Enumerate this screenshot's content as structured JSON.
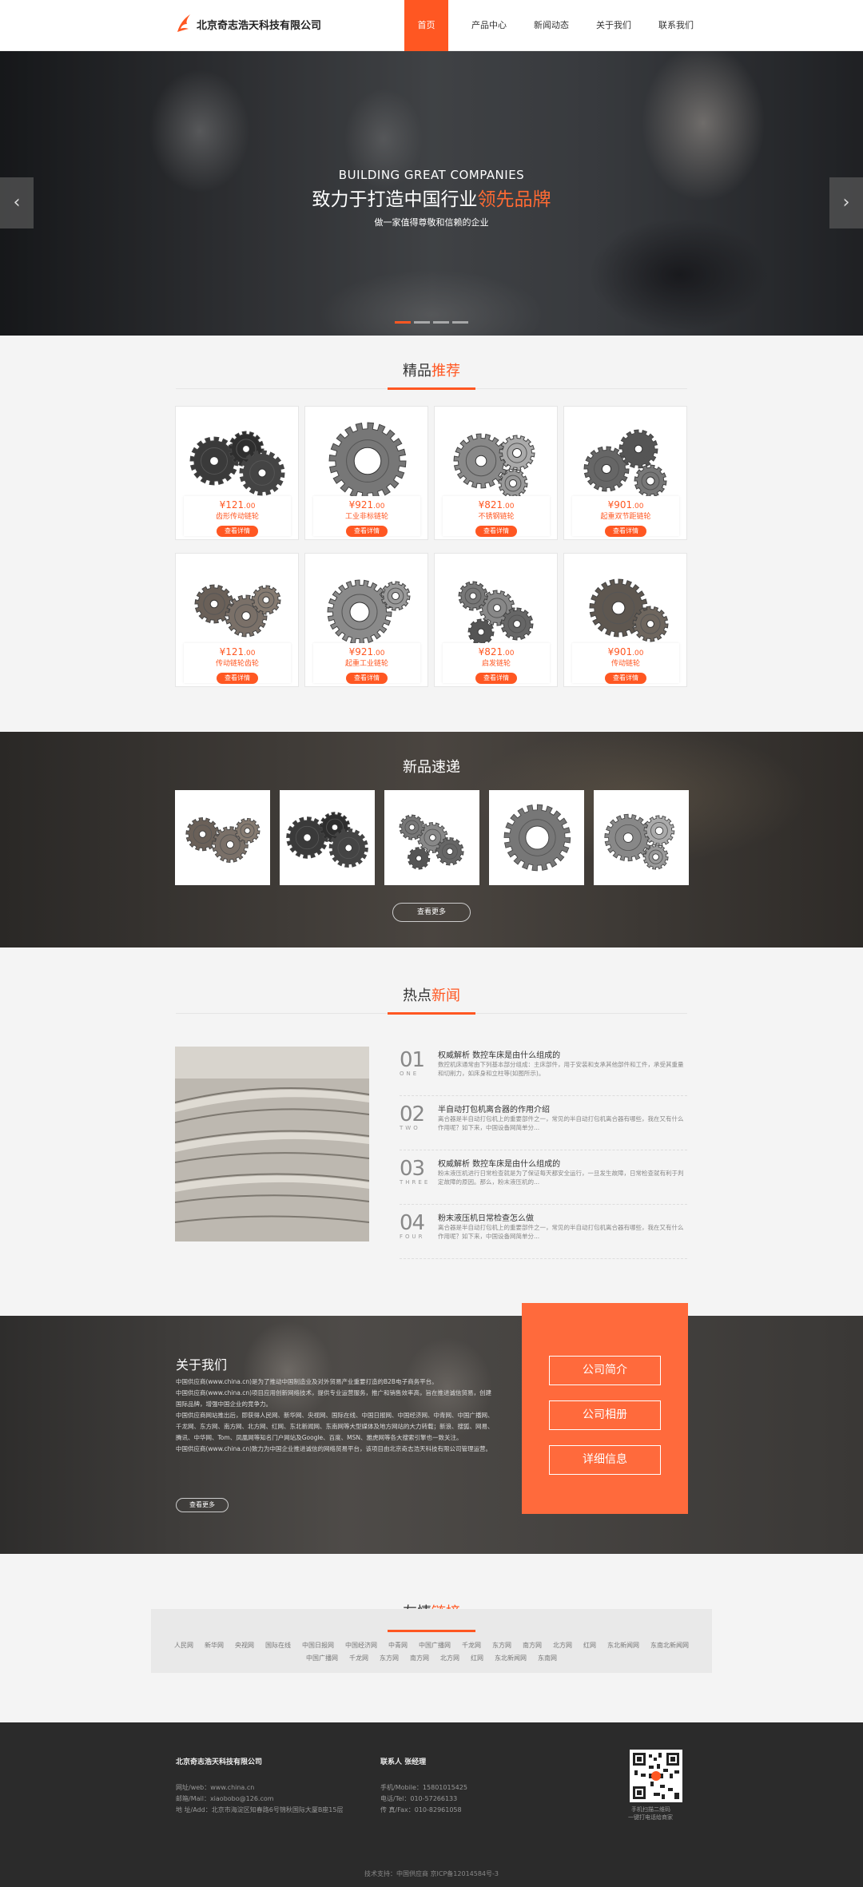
{
  "header": {
    "company": "北京奇志浩天科技有限公司",
    "nav": [
      "首页",
      "产品中心",
      "新闻动态",
      "关于我们",
      "联系我们"
    ]
  },
  "hero": {
    "en": "BUILDING GREAT COMPANIES",
    "cn_prefix": "致力于打造中国行业",
    "cn_accent": "领先品牌",
    "sub": "做一家值得尊敬和信赖的企业",
    "prev": "‹",
    "next": "›"
  },
  "featured": {
    "title_a": "精品",
    "title_b": "推荐",
    "button": "查看详情",
    "items": [
      {
        "price": "¥121",
        "cents": ".00",
        "name": "齿形传动链轮"
      },
      {
        "price": "¥921",
        "cents": ".00",
        "name": "工业非标链轮"
      },
      {
        "price": "¥821",
        "cents": ".00",
        "name": "不锈钢链轮"
      },
      {
        "price": "¥901",
        "cents": ".00",
        "name": "起重双节距链轮"
      },
      {
        "price": "¥121",
        "cents": ".00",
        "name": "传动链轮齿轮"
      },
      {
        "price": "¥921",
        "cents": ".00",
        "name": "起重工业链轮"
      },
      {
        "price": "¥821",
        "cents": ".00",
        "name": "启发链轮"
      },
      {
        "price": "¥901",
        "cents": ".00",
        "name": "传动链轮"
      }
    ]
  },
  "new_products": {
    "title": "新品速递",
    "more": "查看更多"
  },
  "news": {
    "title_a": "热点",
    "title_b": "新闻",
    "items": [
      {
        "num": "01",
        "label": "ONE",
        "title": "权威解析 数控车床是由什么组成的",
        "desc": "数控机床通常由下列基本部分组成：主床部件，用于安装和支承其他部件和工件，承受其重量和切削力，如床身和立柱等(如图所示)。"
      },
      {
        "num": "02",
        "label": "TWO",
        "title": "半自动打包机离合器的作用介绍",
        "desc": "离合器是半自动打包机上的重要部件之一，常见的半自动打包机离合器有哪些，我在又有什么作用呢？如下来，中国设备网简单分..."
      },
      {
        "num": "03",
        "label": "THREE",
        "title": "权威解析 数控车床是由什么组成的",
        "desc": "粉末液压机进行日常检查就是为了保证每天都安全运行，一旦发生故障，日常检查就有利于判定故障的原因。那么，粉末液压机的..."
      },
      {
        "num": "04",
        "label": "FOUR",
        "title": "粉末液压机日常检查怎么做",
        "desc": "离合器是半自动打包机上的重要部件之一，常见的半自动打包机离合器有哪些，我在又有什么作用呢？如下来，中国设备网简单分..."
      }
    ]
  },
  "about": {
    "title": "关于我们",
    "paragraphs": [
      "中国供应商(www.china.cn)是为了推动中国制造业及对外贸易产业重要打造的B2B电子商务平台。",
      "中国供应商(www.china.cn)项目应用创新网络技术，提供专业运营服务，推广和销售效率高，旨在推进诚信贸易，创建国际品牌，增强中国企业的竞争力。",
      "中国供应商网站推出后，即获得人民网、新华网、央视网、国际在线、中国日报网、中国经济网、中青网、中国广播网、千龙网、东方网、南方网、北方网、红网、东北新闻网、东南网等大型媒体及地方网站的大力转载；新浪、搜狐、网易、腾讯、中华网、Tom、凤凰网等知名门户网站及Google、百度、MSN、雅虎网等各大搜索引擎也一致关注。",
      "中国供应商(www.china.cn)致力为中国企业推进诚信的网络贸易平台，该项目由北京奇志浩天科技有限公司管理运营。"
    ],
    "more": "查看更多",
    "links": [
      "公司简介",
      "公司相册",
      "详细信息"
    ]
  },
  "friends": {
    "title_a": "友情",
    "title_b": "链接",
    "row1": [
      "人民网",
      "新华网",
      "央视网",
      "国际在线",
      "中国日报网",
      "中国经济网",
      "中青网",
      "中国广播网",
      "千龙网",
      "东方网",
      "南方网",
      "北方网",
      "红网",
      "东北新闻网",
      "东南北新闻网"
    ],
    "row2": [
      "中国广播网",
      "千龙网",
      "东方网",
      "南方网",
      "北方网",
      "红网",
      "东北新闻网",
      "东南网"
    ]
  },
  "footer": {
    "company": "北京奇志浩天科技有限公司",
    "web": "网址/web：www.china.cn",
    "mail": "邮箱/Mail：xiaobobo@126.com",
    "addr": "地 址/Add：北京市海淀区知春路6号锦秋国际大厦B座15层",
    "contact": "联系人  张经理",
    "mobile": "手机/Mobile：15801015425",
    "tel": "电话/Tel：010-57266133",
    "fax": "传 真/Fax：010-82961058",
    "qr_caption1": "手机扫描二维码",
    "qr_caption2": "一键打电话给商家",
    "copyright": "技术支持：中国供应商  京ICP备12014584号-3"
  },
  "colors": {
    "accent": "#ff5722"
  }
}
